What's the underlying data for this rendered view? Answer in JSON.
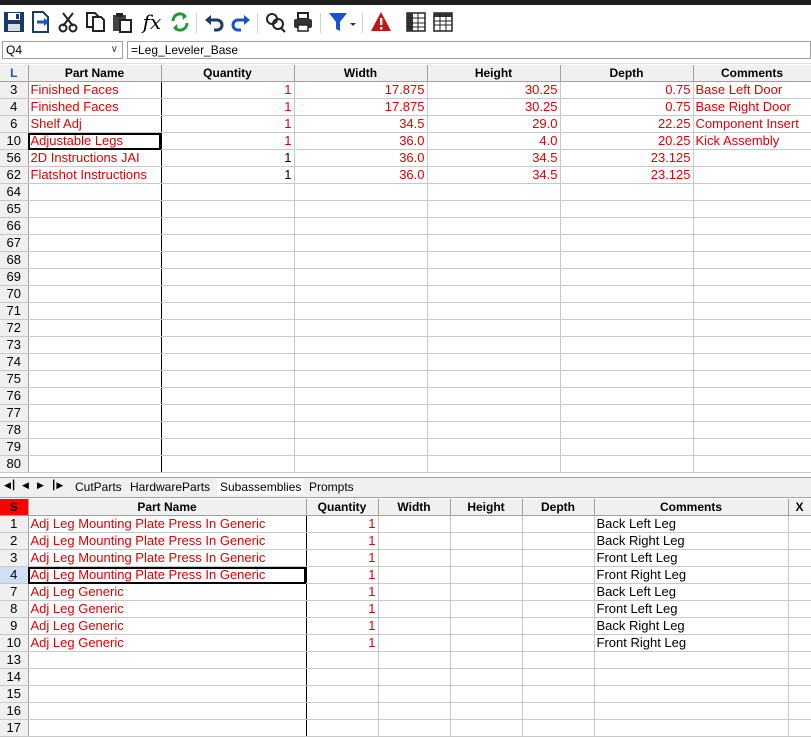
{
  "toolbar": {
    "icons": [
      "save-icon",
      "export-icon",
      "cut-icon",
      "copy-icon",
      "paste-icon",
      "function-icon",
      "refresh-icon",
      "undo-icon",
      "redo-icon",
      "find-icon",
      "print-icon",
      "filter-icon",
      "warning-icon",
      "grid-view-icon",
      "table-view-icon"
    ],
    "fx_label": "fx"
  },
  "formula_bar": {
    "cell_ref": "Q4",
    "formula": "=Leg_Leveler_Base"
  },
  "upper_grid": {
    "corner": "L",
    "columns": [
      "Part Name",
      "Quantity",
      "Width",
      "Height",
      "Depth",
      "Comments"
    ],
    "rows": [
      {
        "n": "3",
        "name": "Finished Faces",
        "qty": "1",
        "width": "17.875",
        "height": "30.25",
        "depth": "0.75",
        "comments": "Base Left Door",
        "red": true
      },
      {
        "n": "4",
        "name": "Finished Faces",
        "qty": "1",
        "width": "17.875",
        "height": "30.25",
        "depth": "0.75",
        "comments": "Base Right Door",
        "red": true
      },
      {
        "n": "6",
        "name": "Shelf Adj",
        "qty": "1",
        "width": "34.5",
        "height": "29.0",
        "depth": "22.25",
        "comments": "Component Insert",
        "red": true
      },
      {
        "n": "10",
        "name": "Adjustable Legs",
        "qty": "1",
        "width": "36.0",
        "height": "4.0",
        "depth": "20.25",
        "comments": "Kick Assembly",
        "red": true
      },
      {
        "n": "56",
        "name": "2D Instructions JAI",
        "qty": "1",
        "width": "36.0",
        "height": "34.5",
        "depth": "23.125",
        "comments": "",
        "red": true
      },
      {
        "n": "62",
        "name": "Flatshot Instructions",
        "qty": "1",
        "width": "36.0",
        "height": "34.5",
        "depth": "23.125",
        "comments": "",
        "red": true
      },
      {
        "n": "64"
      },
      {
        "n": "65"
      },
      {
        "n": "66"
      },
      {
        "n": "67"
      },
      {
        "n": "68"
      },
      {
        "n": "69"
      },
      {
        "n": "70"
      },
      {
        "n": "71"
      },
      {
        "n": "72"
      },
      {
        "n": "73"
      },
      {
        "n": "74"
      },
      {
        "n": "75"
      },
      {
        "n": "76"
      },
      {
        "n": "77"
      },
      {
        "n": "78"
      },
      {
        "n": "79"
      },
      {
        "n": "80"
      }
    ]
  },
  "tabs": [
    "CutParts",
    "HardwareParts",
    "Subassemblies",
    "Prompts"
  ],
  "active_tab": "Subassemblies",
  "lower_grid": {
    "corner": "S",
    "columns": [
      "Part Name",
      "Quantity",
      "Width",
      "Height",
      "Depth",
      "Comments",
      "X"
    ],
    "rows": [
      {
        "n": "1",
        "name": "Adj Leg Mounting Plate Press In Generic",
        "qty": "1",
        "comments": "Back Left Leg"
      },
      {
        "n": "2",
        "name": "Adj Leg Mounting Plate Press In Generic",
        "qty": "1",
        "comments": "Back Right Leg"
      },
      {
        "n": "3",
        "name": "Adj Leg Mounting Plate Press In Generic",
        "qty": "1",
        "comments": "Front Left Leg"
      },
      {
        "n": "4",
        "name": "Adj Leg Mounting Plate Press In Generic",
        "qty": "1",
        "comments": "Front Right Leg"
      },
      {
        "n": "7",
        "name": "Adj Leg Generic",
        "qty": "1",
        "comments": "Back Left Leg"
      },
      {
        "n": "8",
        "name": "Adj Leg Generic",
        "qty": "1",
        "comments": "Front Left Leg"
      },
      {
        "n": "9",
        "name": "Adj Leg Generic",
        "qty": "1",
        "comments": "Back Right Leg"
      },
      {
        "n": "10",
        "name": "Adj Leg Generic",
        "qty": "1",
        "comments": "Front Right Leg"
      },
      {
        "n": "13"
      },
      {
        "n": "14"
      },
      {
        "n": "15"
      },
      {
        "n": "16"
      },
      {
        "n": "17"
      }
    ]
  },
  "colors": {
    "data_red": "#e00000",
    "accent_blue": "#1a52c9",
    "header_gray": "#f0f0f0"
  }
}
